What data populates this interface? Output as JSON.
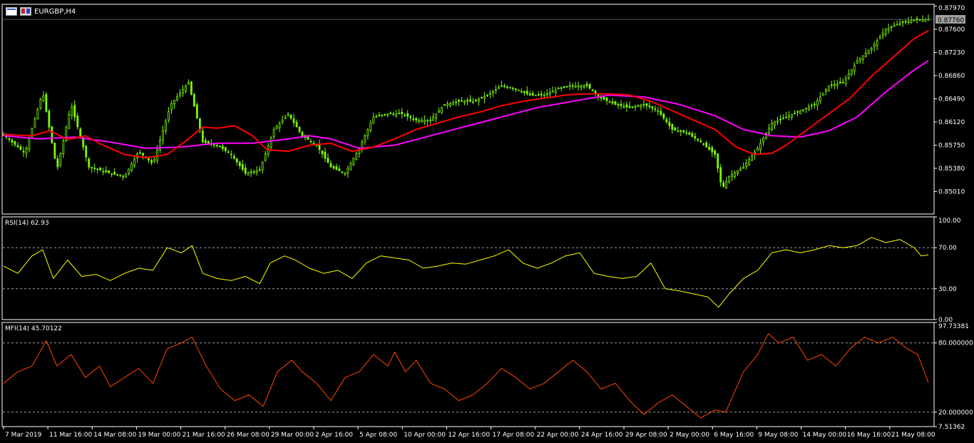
{
  "symbol": {
    "label": "EURGBP,H4"
  },
  "current_price": "0.87760",
  "colors": {
    "background": "#000000",
    "candle": "#7CFC00",
    "ma_fast": "#ff0000",
    "ma_slow": "#ff00ff",
    "rsi": "#ffff00",
    "mfi": "#ff4500",
    "axis": "#ffffff",
    "level": "#a0a0a0"
  },
  "chart_data": [
    {
      "type": "candlestick",
      "title": "EURGBP,H4",
      "ylim": [
        0.8465,
        0.88
      ],
      "y_ticks": [
        "0.87970",
        "0.87600",
        "0.87230",
        "0.86860",
        "0.86490",
        "0.86120",
        "0.85750",
        "0.85380",
        "0.85010"
      ],
      "y_tick_values": [
        0.8797,
        0.876,
        0.8723,
        0.8686,
        0.8649,
        0.8612,
        0.8575,
        0.8538,
        0.8501
      ],
      "close_series": [
        [
          0,
          0.8592
        ],
        [
          30,
          0.8562
        ],
        [
          55,
          0.866
        ],
        [
          75,
          0.8535
        ],
        [
          95,
          0.864
        ],
        [
          120,
          0.854
        ],
        [
          150,
          0.853
        ],
        [
          170,
          0.8525
        ],
        [
          190,
          0.8565
        ],
        [
          210,
          0.8545
        ],
        [
          235,
          0.864
        ],
        [
          260,
          0.8675
        ],
        [
          280,
          0.858
        ],
        [
          300,
          0.8575
        ],
        [
          320,
          0.856
        ],
        [
          340,
          0.853
        ],
        [
          360,
          0.8535
        ],
        [
          380,
          0.86
        ],
        [
          400,
          0.8625
        ],
        [
          420,
          0.859
        ],
        [
          440,
          0.8575
        ],
        [
          460,
          0.854
        ],
        [
          480,
          0.853
        ],
        [
          500,
          0.857
        ],
        [
          520,
          0.862
        ],
        [
          540,
          0.8625
        ],
        [
          560,
          0.8625
        ],
        [
          580,
          0.8615
        ],
        [
          600,
          0.8615
        ],
        [
          620,
          0.864
        ],
        [
          640,
          0.8645
        ],
        [
          660,
          0.8645
        ],
        [
          680,
          0.8655
        ],
        [
          700,
          0.867
        ],
        [
          720,
          0.8665
        ],
        [
          740,
          0.8655
        ],
        [
          760,
          0.8655
        ],
        [
          780,
          0.8665
        ],
        [
          800,
          0.867
        ],
        [
          820,
          0.867
        ],
        [
          840,
          0.865
        ],
        [
          860,
          0.864
        ],
        [
          880,
          0.8635
        ],
        [
          900,
          0.864
        ],
        [
          920,
          0.863
        ],
        [
          940,
          0.86
        ],
        [
          960,
          0.8595
        ],
        [
          980,
          0.858
        ],
        [
          1000,
          0.856
        ],
        [
          1010,
          0.8505
        ],
        [
          1020,
          0.8525
        ],
        [
          1040,
          0.854
        ],
        [
          1060,
          0.857
        ],
        [
          1080,
          0.861
        ],
        [
          1100,
          0.862
        ],
        [
          1120,
          0.863
        ],
        [
          1140,
          0.864
        ],
        [
          1160,
          0.867
        ],
        [
          1180,
          0.8675
        ],
        [
          1200,
          0.871
        ],
        [
          1220,
          0.873
        ],
        [
          1240,
          0.876
        ],
        [
          1260,
          0.877
        ],
        [
          1280,
          0.8775
        ],
        [
          1300,
          0.8776
        ]
      ],
      "ma_fast": [
        [
          0,
          0.8592
        ],
        [
          40,
          0.859
        ],
        [
          65,
          0.8598
        ],
        [
          90,
          0.8584
        ],
        [
          115,
          0.859
        ],
        [
          140,
          0.8575
        ],
        [
          170,
          0.856
        ],
        [
          200,
          0.8555
        ],
        [
          230,
          0.856
        ],
        [
          260,
          0.8585
        ],
        [
          280,
          0.8604
        ],
        [
          300,
          0.8602
        ],
        [
          325,
          0.8606
        ],
        [
          350,
          0.859
        ],
        [
          370,
          0.8568
        ],
        [
          400,
          0.8565
        ],
        [
          430,
          0.8575
        ],
        [
          460,
          0.8578
        ],
        [
          490,
          0.8565
        ],
        [
          520,
          0.8572
        ],
        [
          550,
          0.8585
        ],
        [
          580,
          0.86
        ],
        [
          610,
          0.861
        ],
        [
          640,
          0.862
        ],
        [
          670,
          0.8628
        ],
        [
          700,
          0.8638
        ],
        [
          730,
          0.8645
        ],
        [
          760,
          0.865
        ],
        [
          790,
          0.8655
        ],
        [
          820,
          0.8657
        ],
        [
          850,
          0.8657
        ],
        [
          880,
          0.8655
        ],
        [
          910,
          0.8645
        ],
        [
          940,
          0.863
        ],
        [
          970,
          0.8615
        ],
        [
          1000,
          0.86
        ],
        [
          1030,
          0.8572
        ],
        [
          1055,
          0.856
        ],
        [
          1080,
          0.8562
        ],
        [
          1100,
          0.8575
        ],
        [
          1130,
          0.86
        ],
        [
          1160,
          0.8625
        ],
        [
          1190,
          0.865
        ],
        [
          1220,
          0.8685
        ],
        [
          1250,
          0.8715
        ],
        [
          1280,
          0.8745
        ],
        [
          1300,
          0.8758
        ]
      ],
      "ma_slow": [
        [
          0,
          0.859
        ],
        [
          50,
          0.8585
        ],
        [
          100,
          0.8588
        ],
        [
          150,
          0.858
        ],
        [
          200,
          0.857
        ],
        [
          250,
          0.8572
        ],
        [
          300,
          0.8578
        ],
        [
          350,
          0.8578
        ],
        [
          400,
          0.8585
        ],
        [
          430,
          0.859
        ],
        [
          460,
          0.8585
        ],
        [
          500,
          0.857
        ],
        [
          550,
          0.8575
        ],
        [
          600,
          0.859
        ],
        [
          650,
          0.8605
        ],
        [
          700,
          0.862
        ],
        [
          750,
          0.8635
        ],
        [
          800,
          0.8645
        ],
        [
          850,
          0.8655
        ],
        [
          900,
          0.8652
        ],
        [
          950,
          0.864
        ],
        [
          1000,
          0.8622
        ],
        [
          1040,
          0.86
        ],
        [
          1080,
          0.859
        ],
        [
          1120,
          0.8588
        ],
        [
          1160,
          0.8598
        ],
        [
          1200,
          0.862
        ],
        [
          1240,
          0.866
        ],
        [
          1280,
          0.8695
        ],
        [
          1300,
          0.871
        ]
      ]
    },
    {
      "type": "line",
      "title": "RSI(14) 62.93",
      "ylim": [
        0,
        100
      ],
      "y_ticks": [
        "100.00",
        "70.00",
        "30.00",
        "0.00"
      ],
      "y_tick_values": [
        100,
        70,
        30,
        0
      ],
      "levels": [
        70,
        30
      ],
      "series": [
        [
          0,
          52
        ],
        [
          20,
          45
        ],
        [
          40,
          62
        ],
        [
          55,
          68
        ],
        [
          70,
          40
        ],
        [
          90,
          58
        ],
        [
          110,
          42
        ],
        [
          130,
          44
        ],
        [
          150,
          38
        ],
        [
          170,
          45
        ],
        [
          190,
          50
        ],
        [
          210,
          48
        ],
        [
          230,
          70
        ],
        [
          250,
          65
        ],
        [
          265,
          72
        ],
        [
          280,
          45
        ],
        [
          300,
          40
        ],
        [
          320,
          38
        ],
        [
          340,
          42
        ],
        [
          360,
          35
        ],
        [
          375,
          55
        ],
        [
          395,
          62
        ],
        [
          410,
          58
        ],
        [
          430,
          50
        ],
        [
          450,
          45
        ],
        [
          470,
          48
        ],
        [
          490,
          40
        ],
        [
          510,
          55
        ],
        [
          530,
          62
        ],
        [
          550,
          60
        ],
        [
          570,
          58
        ],
        [
          590,
          50
        ],
        [
          610,
          52
        ],
        [
          630,
          55
        ],
        [
          650,
          54
        ],
        [
          670,
          58
        ],
        [
          690,
          62
        ],
        [
          710,
          68
        ],
        [
          730,
          55
        ],
        [
          750,
          50
        ],
        [
          770,
          55
        ],
        [
          790,
          62
        ],
        [
          810,
          65
        ],
        [
          830,
          45
        ],
        [
          850,
          42
        ],
        [
          870,
          40
        ],
        [
          890,
          42
        ],
        [
          910,
          55
        ],
        [
          930,
          30
        ],
        [
          950,
          28
        ],
        [
          970,
          25
        ],
        [
          990,
          22
        ],
        [
          1005,
          12
        ],
        [
          1020,
          25
        ],
        [
          1040,
          40
        ],
        [
          1060,
          48
        ],
        [
          1080,
          65
        ],
        [
          1100,
          68
        ],
        [
          1120,
          65
        ],
        [
          1140,
          68
        ],
        [
          1160,
          72
        ],
        [
          1180,
          70
        ],
        [
          1200,
          72
        ],
        [
          1220,
          80
        ],
        [
          1240,
          75
        ],
        [
          1260,
          78
        ],
        [
          1280,
          70
        ],
        [
          1290,
          62
        ],
        [
          1300,
          62.93
        ]
      ]
    },
    {
      "type": "line",
      "title": "MFI(14) 45.70122",
      "ylim": [
        7.51362,
        97.73381
      ],
      "y_ticks": [
        "97.73381",
        "80.000000",
        "20.000000",
        "7.51362"
      ],
      "y_tick_values": [
        97.73381,
        80,
        20,
        7.51362
      ],
      "levels": [
        80,
        20
      ],
      "series": [
        [
          0,
          45
        ],
        [
          20,
          55
        ],
        [
          40,
          60
        ],
        [
          60,
          82
        ],
        [
          75,
          60
        ],
        [
          95,
          70
        ],
        [
          115,
          50
        ],
        [
          135,
          60
        ],
        [
          150,
          42
        ],
        [
          170,
          50
        ],
        [
          190,
          58
        ],
        [
          210,
          45
        ],
        [
          230,
          75
        ],
        [
          250,
          80
        ],
        [
          265,
          85
        ],
        [
          285,
          60
        ],
        [
          305,
          40
        ],
        [
          325,
          30
        ],
        [
          345,
          35
        ],
        [
          365,
          25
        ],
        [
          385,
          55
        ],
        [
          405,
          65
        ],
        [
          420,
          55
        ],
        [
          440,
          45
        ],
        [
          460,
          30
        ],
        [
          480,
          50
        ],
        [
          500,
          55
        ],
        [
          520,
          70
        ],
        [
          540,
          60
        ],
        [
          550,
          72
        ],
        [
          565,
          55
        ],
        [
          580,
          65
        ],
        [
          600,
          45
        ],
        [
          620,
          40
        ],
        [
          640,
          30
        ],
        [
          660,
          35
        ],
        [
          680,
          45
        ],
        [
          700,
          58
        ],
        [
          720,
          50
        ],
        [
          740,
          40
        ],
        [
          760,
          45
        ],
        [
          780,
          55
        ],
        [
          800,
          65
        ],
        [
          820,
          55
        ],
        [
          840,
          40
        ],
        [
          860,
          45
        ],
        [
          880,
          30
        ],
        [
          900,
          18
        ],
        [
          920,
          28
        ],
        [
          940,
          35
        ],
        [
          960,
          25
        ],
        [
          980,
          15
        ],
        [
          1000,
          22
        ],
        [
          1015,
          20
        ],
        [
          1040,
          55
        ],
        [
          1060,
          70
        ],
        [
          1075,
          88
        ],
        [
          1090,
          80
        ],
        [
          1110,
          85
        ],
        [
          1130,
          65
        ],
        [
          1150,
          70
        ],
        [
          1170,
          60
        ],
        [
          1190,
          75
        ],
        [
          1210,
          85
        ],
        [
          1230,
          80
        ],
        [
          1250,
          85
        ],
        [
          1270,
          75
        ],
        [
          1285,
          70
        ],
        [
          1300,
          45.70122
        ]
      ]
    }
  ],
  "x_axis": {
    "labels": [
      "7 Mar 2019",
      "11 Mar 16:00",
      "14 Mar 08:00",
      "19 Mar 00:00",
      "21 Mar 16:00",
      "26 Mar 08:00",
      "29 Mar 00:00",
      "2 Apr 16:00",
      "5 Apr 08:00",
      "10 Apr 00:00",
      "12 Apr 16:00",
      "17 Apr 08:00",
      "22 Apr 00:00",
      "24 Apr 16:00",
      "29 Apr 08:00",
      "2 May 00:00",
      "6 May 16:00",
      "9 May 08:00",
      "14 May 00:00",
      "16 May 16:00",
      "21 May 08:00"
    ]
  }
}
